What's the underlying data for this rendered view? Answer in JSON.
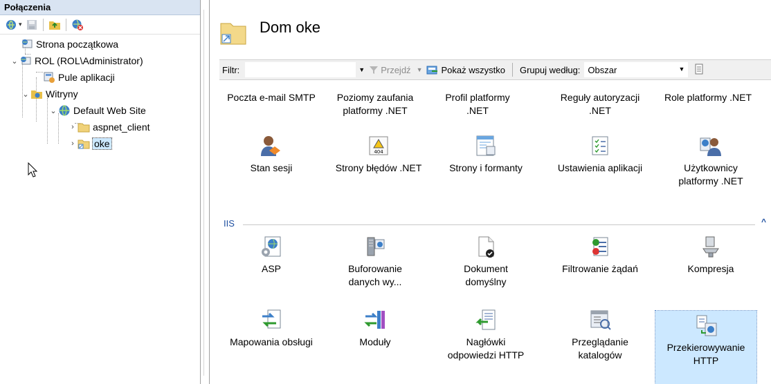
{
  "connections": {
    "header": "Połączenia",
    "toolbar_icons": [
      "connect-icon",
      "save-icon",
      "folder-up-icon",
      "disconnect-icon"
    ],
    "tree": [
      {
        "label": "Strona początkowa",
        "icon": "start-page-icon"
      },
      {
        "label": "ROL (ROL\\Administrator)",
        "icon": "server-icon"
      },
      {
        "label": "Pule aplikacji",
        "icon": "app-pools-icon"
      },
      {
        "label": "Witryny",
        "icon": "sites-folder-icon"
      },
      {
        "label": "Default Web Site",
        "icon": "globe-icon"
      },
      {
        "label": "aspnet_client",
        "icon": "folder-icon"
      },
      {
        "label": "oke",
        "icon": "app-folder-icon"
      }
    ]
  },
  "main": {
    "title": "Dom oke",
    "filter": {
      "label": "Filtr:",
      "value": "",
      "go_label": "Przejdź",
      "show_all_label": "Pokaż wszystko",
      "group_by_label": "Grupuj według:",
      "group_by_value": "Obszar"
    },
    "aspnet_row_partial": [
      {
        "label": "Poczta e-mail SMTP"
      },
      {
        "label": "Poziomy zaufania platformy .NET"
      },
      {
        "label": "Profil platformy .NET"
      },
      {
        "label": "Reguły autoryzacji .NET"
      },
      {
        "label": "Role platformy .NET"
      }
    ],
    "aspnet_row2": [
      {
        "label": "Stan sesji",
        "icon": "session-state-icon"
      },
      {
        "label": "Strony błędów .NET",
        "icon": "error-pages-icon"
      },
      {
        "label": "Strony i formanty",
        "icon": "pages-controls-icon"
      },
      {
        "label": "Ustawienia aplikacji",
        "icon": "app-settings-icon"
      },
      {
        "label": "Użytkownicy platformy .NET",
        "icon": "net-users-icon"
      }
    ],
    "iis_group": {
      "label": "IIS",
      "row1": [
        {
          "label": "ASP",
          "icon": "asp-icon"
        },
        {
          "label": "Buforowanie danych wy...",
          "icon": "output-caching-icon"
        },
        {
          "label": "Dokument domyślny",
          "icon": "default-document-icon"
        },
        {
          "label": "Filtrowanie żądań",
          "icon": "request-filtering-icon"
        },
        {
          "label": "Kompresja",
          "icon": "compression-icon"
        }
      ],
      "row2": [
        {
          "label": "Mapowania obsługi",
          "icon": "handler-mappings-icon"
        },
        {
          "label": "Moduły",
          "icon": "modules-icon"
        },
        {
          "label": "Nagłówki odpowiedzi HTTP",
          "icon": "http-headers-icon"
        },
        {
          "label": "Przeglądanie katalogów",
          "icon": "directory-browsing-icon"
        },
        {
          "label": "Przekierowywanie HTTP",
          "icon": "http-redirect-icon",
          "selected": true
        }
      ]
    }
  },
  "colors": {
    "header_bg": "#d9e4f2",
    "selection_bg": "#cce8ff",
    "group_label": "#1e4fa0"
  }
}
